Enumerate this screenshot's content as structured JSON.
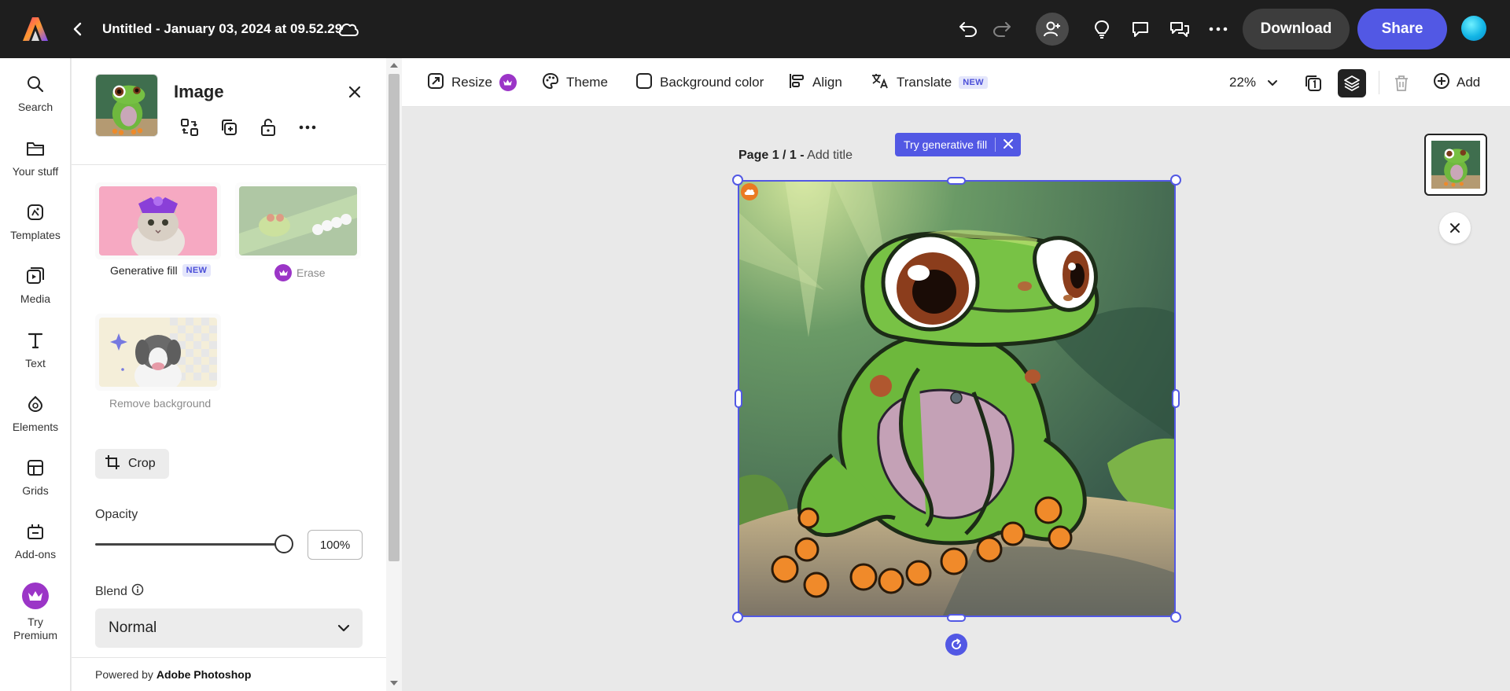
{
  "topbar": {
    "document_title": "Untitled - January 03, 2024 at 09.52.29",
    "download_label": "Download",
    "share_label": "Share",
    "icons": [
      "adobe-express-logo",
      "back-arrow-icon",
      "cloud-icon",
      "undo-icon",
      "redo-icon",
      "invite-user-icon",
      "lightbulb-icon",
      "comment-icon",
      "share-comment-icon",
      "more-icon",
      "user-avatar"
    ]
  },
  "rail": {
    "items": [
      {
        "label": "Search",
        "icon": "search-icon"
      },
      {
        "label": "Your stuff",
        "icon": "folder-icon"
      },
      {
        "label": "Templates",
        "icon": "templates-icon"
      },
      {
        "label": "Media",
        "icon": "media-icon"
      },
      {
        "label": "Text",
        "icon": "text-icon"
      },
      {
        "label": "Elements",
        "icon": "elements-icon"
      },
      {
        "label": "Grids",
        "icon": "grids-icon"
      },
      {
        "label": "Add-ons",
        "icon": "addons-icon"
      }
    ],
    "premium": {
      "label_line1": "Try",
      "label_line2": "Premium",
      "icon": "crown-icon"
    }
  },
  "panel": {
    "title": "Image",
    "quick_actions": [
      "replace-icon",
      "duplicate-icon",
      "unlock-icon",
      "more-icon"
    ],
    "features": [
      {
        "label": "Generative fill",
        "badge": "NEW",
        "enabled": true
      },
      {
        "label": "Erase",
        "premium": true,
        "enabled": false
      },
      {
        "label": "Remove background",
        "enabled": false
      }
    ],
    "crop_label": "Crop",
    "opacity_label": "Opacity",
    "opacity_value": "100%",
    "opacity_fraction": 1.0,
    "blend_label": "Blend",
    "blend_value": "Normal",
    "powered_prefix": "Powered by ",
    "powered_brand": "Adobe Photoshop"
  },
  "canvas_toolbar": {
    "resize_label": "Resize",
    "theme_label": "Theme",
    "background_label": "Background color",
    "align_label": "Align",
    "translate_label": "Translate",
    "translate_badge": "NEW",
    "zoom_value": "22%",
    "add_label": "Add"
  },
  "canvas": {
    "page_indicator": "Page 1 / 1 -",
    "add_title": "Add title",
    "generative_fill_pill": "Try generative fill"
  },
  "colors": {
    "accent": "#5258e4",
    "topbar_bg": "#1e1e1e",
    "premium": "#9b35c7"
  }
}
